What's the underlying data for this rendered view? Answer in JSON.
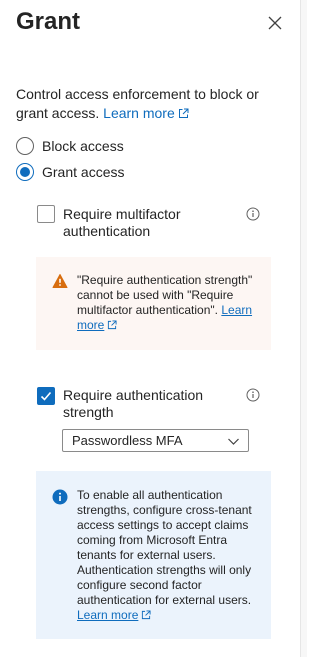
{
  "panel": {
    "title": "Grant",
    "description": "Control access enforcement to block or grant access.",
    "learn_more": "Learn more"
  },
  "access": {
    "options": [
      {
        "label": "Block access",
        "selected": false
      },
      {
        "label": "Grant access",
        "selected": true
      }
    ]
  },
  "controls": {
    "mfa": {
      "label": "Require multifactor authentication",
      "checked": false
    },
    "auth_strength": {
      "label": "Require authentication strength",
      "checked": true,
      "selected_value": "Passwordless MFA"
    }
  },
  "warning": {
    "text": "\"Require authentication strength\" cannot be used with \"Require multifactor authentication\".",
    "learn_more": "Learn more"
  },
  "info": {
    "text": "To enable all authentication strengths, configure cross-tenant access settings to accept claims coming from Microsoft Entra tenants for external users. Authentication strengths will only configure second factor authentication for external users.",
    "learn_more": "Learn more"
  },
  "colors": {
    "accent": "#0f6cbd",
    "warning_icon": "#d86d0e",
    "warning_bg": "#fdf6f3",
    "info_bg": "#ebf3fc"
  },
  "icons": {
    "close": "close-icon",
    "external": "external-link-icon",
    "info": "info-icon",
    "warning": "warning-icon",
    "dropdown": "chevron-down-icon"
  }
}
